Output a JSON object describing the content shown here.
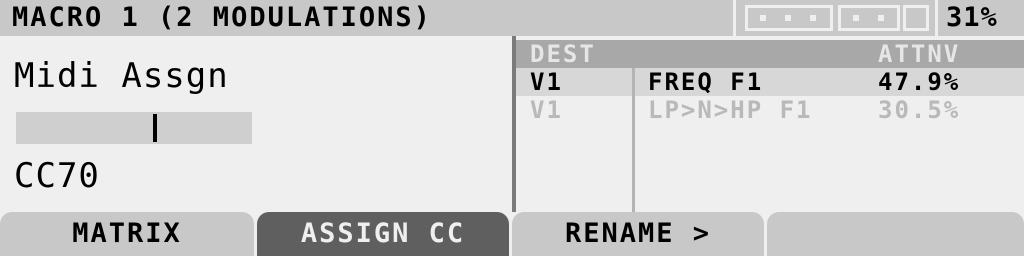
{
  "header": {
    "title": "MACRO 1 (2 MODULATIONS)",
    "cpu_load": "31%"
  },
  "parameter": {
    "name": "Midi Assgn",
    "value": "CC70",
    "slider_level": 0.59
  },
  "mod_table": {
    "headers": {
      "dest": "DEST",
      "attnv": "ATTNV"
    },
    "rows": [
      {
        "source": "V1",
        "dest": "FREQ F1",
        "amount": "47.9%",
        "selected": true
      },
      {
        "source": "V1",
        "dest": "LP>N>HP F1",
        "amount": "30.5%",
        "selected": false
      }
    ]
  },
  "buttons": [
    {
      "label": "MATRIX",
      "active": false
    },
    {
      "label": "ASSIGN CC",
      "active": true
    },
    {
      "label": "RENAME >",
      "active": false
    },
    {
      "label": "",
      "active": false
    }
  ]
}
